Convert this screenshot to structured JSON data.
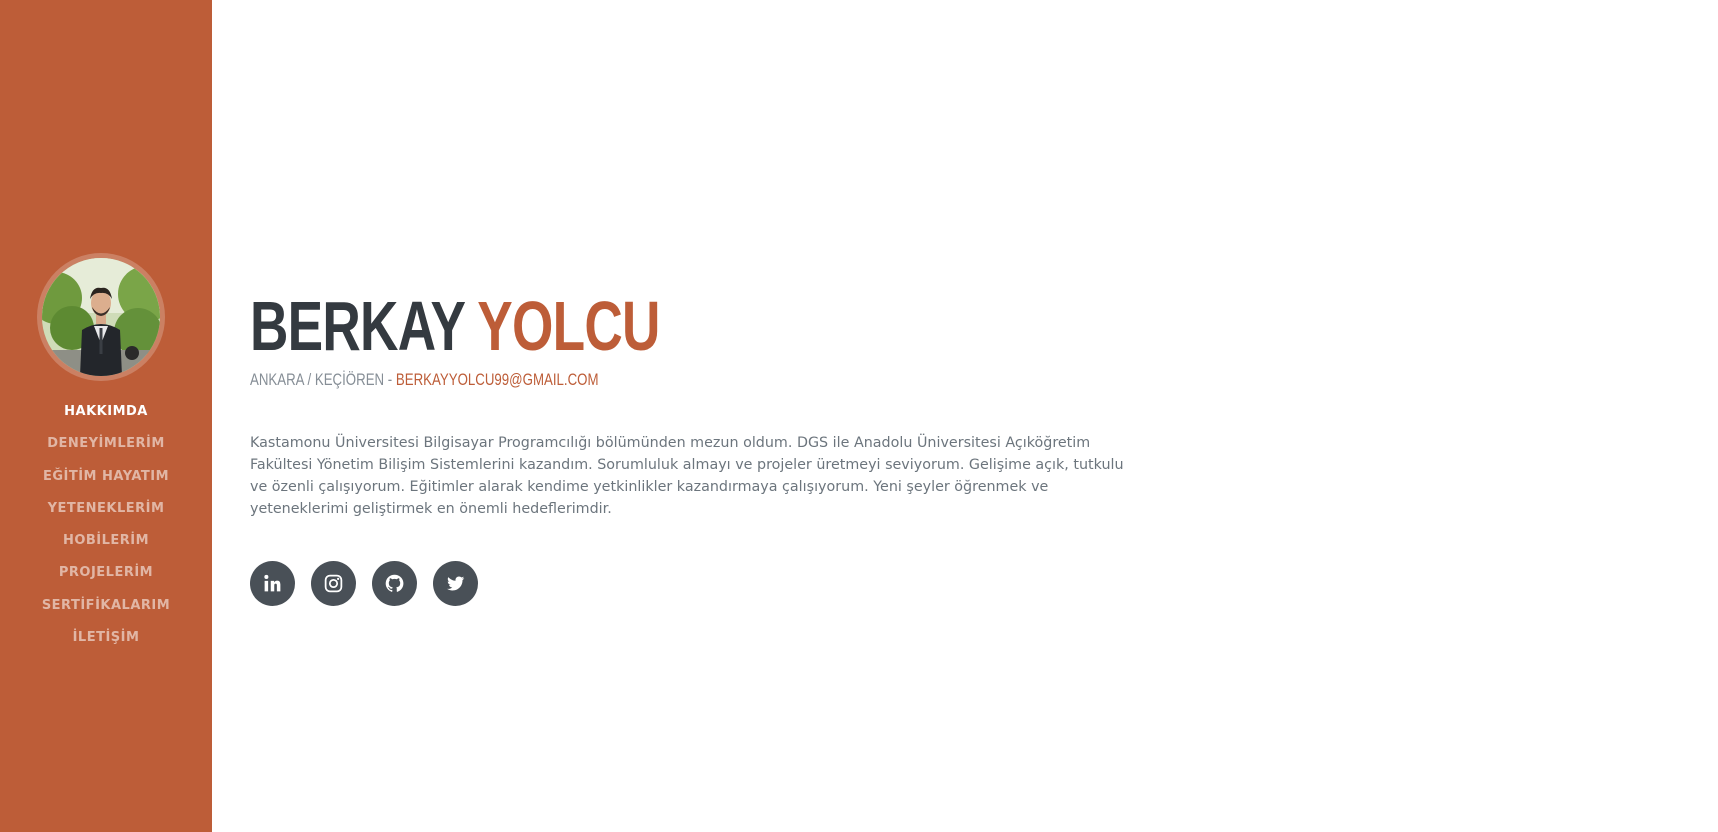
{
  "sidebar": {
    "avatar_icon": "profile-photo",
    "nav_items": [
      {
        "label": "HAKKIMDA",
        "active": true
      },
      {
        "label": "DENEYİMLERİM",
        "active": false
      },
      {
        "label": "EĞİTİM HAYATIM",
        "active": false
      },
      {
        "label": "YETENEKLERİM",
        "active": false
      },
      {
        "label": "HOBİLERİM",
        "active": false
      },
      {
        "label": "PROJELERİM",
        "active": false
      },
      {
        "label": "SERTİFİKALARIM",
        "active": false
      },
      {
        "label": "İLETİŞİM",
        "active": false
      }
    ]
  },
  "about": {
    "first_name": "BERKAY",
    "last_name": "YOLCU",
    "location": "ANKARA / KEÇİÖREN",
    "separator": "-",
    "email": "BERKAYYOLCU99@GMAIL.COM",
    "bio": "Kastamonu Üniversitesi Bilgisayar Programcılığı bölümünden mezun oldum. DGS ile Anadolu Üniversitesi Açıköğretim Fakültesi Yönetim Bilişim Sistemlerini kazandım. Sorumluluk almayı ve projeler üretmeyi seviyorum. Gelişime açık, tutkulu ve özenli çalışıyorum. Eğitimler alarak kendime yetkinlikler kazandırmaya çalışıyorum. Yeni şeyler öğrenmek ve yeteneklerimi geliştirmek en önemli hedeflerimdir."
  },
  "social": [
    {
      "icon": "linkedin-icon"
    },
    {
      "icon": "instagram-icon"
    },
    {
      "icon": "github-icon"
    },
    {
      "icon": "twitter-icon"
    }
  ],
  "colors": {
    "primary": "#bd5d38",
    "heading": "#343a40",
    "muted": "#868e96",
    "body_text": "#6c757d",
    "social_bg": "#495057"
  }
}
